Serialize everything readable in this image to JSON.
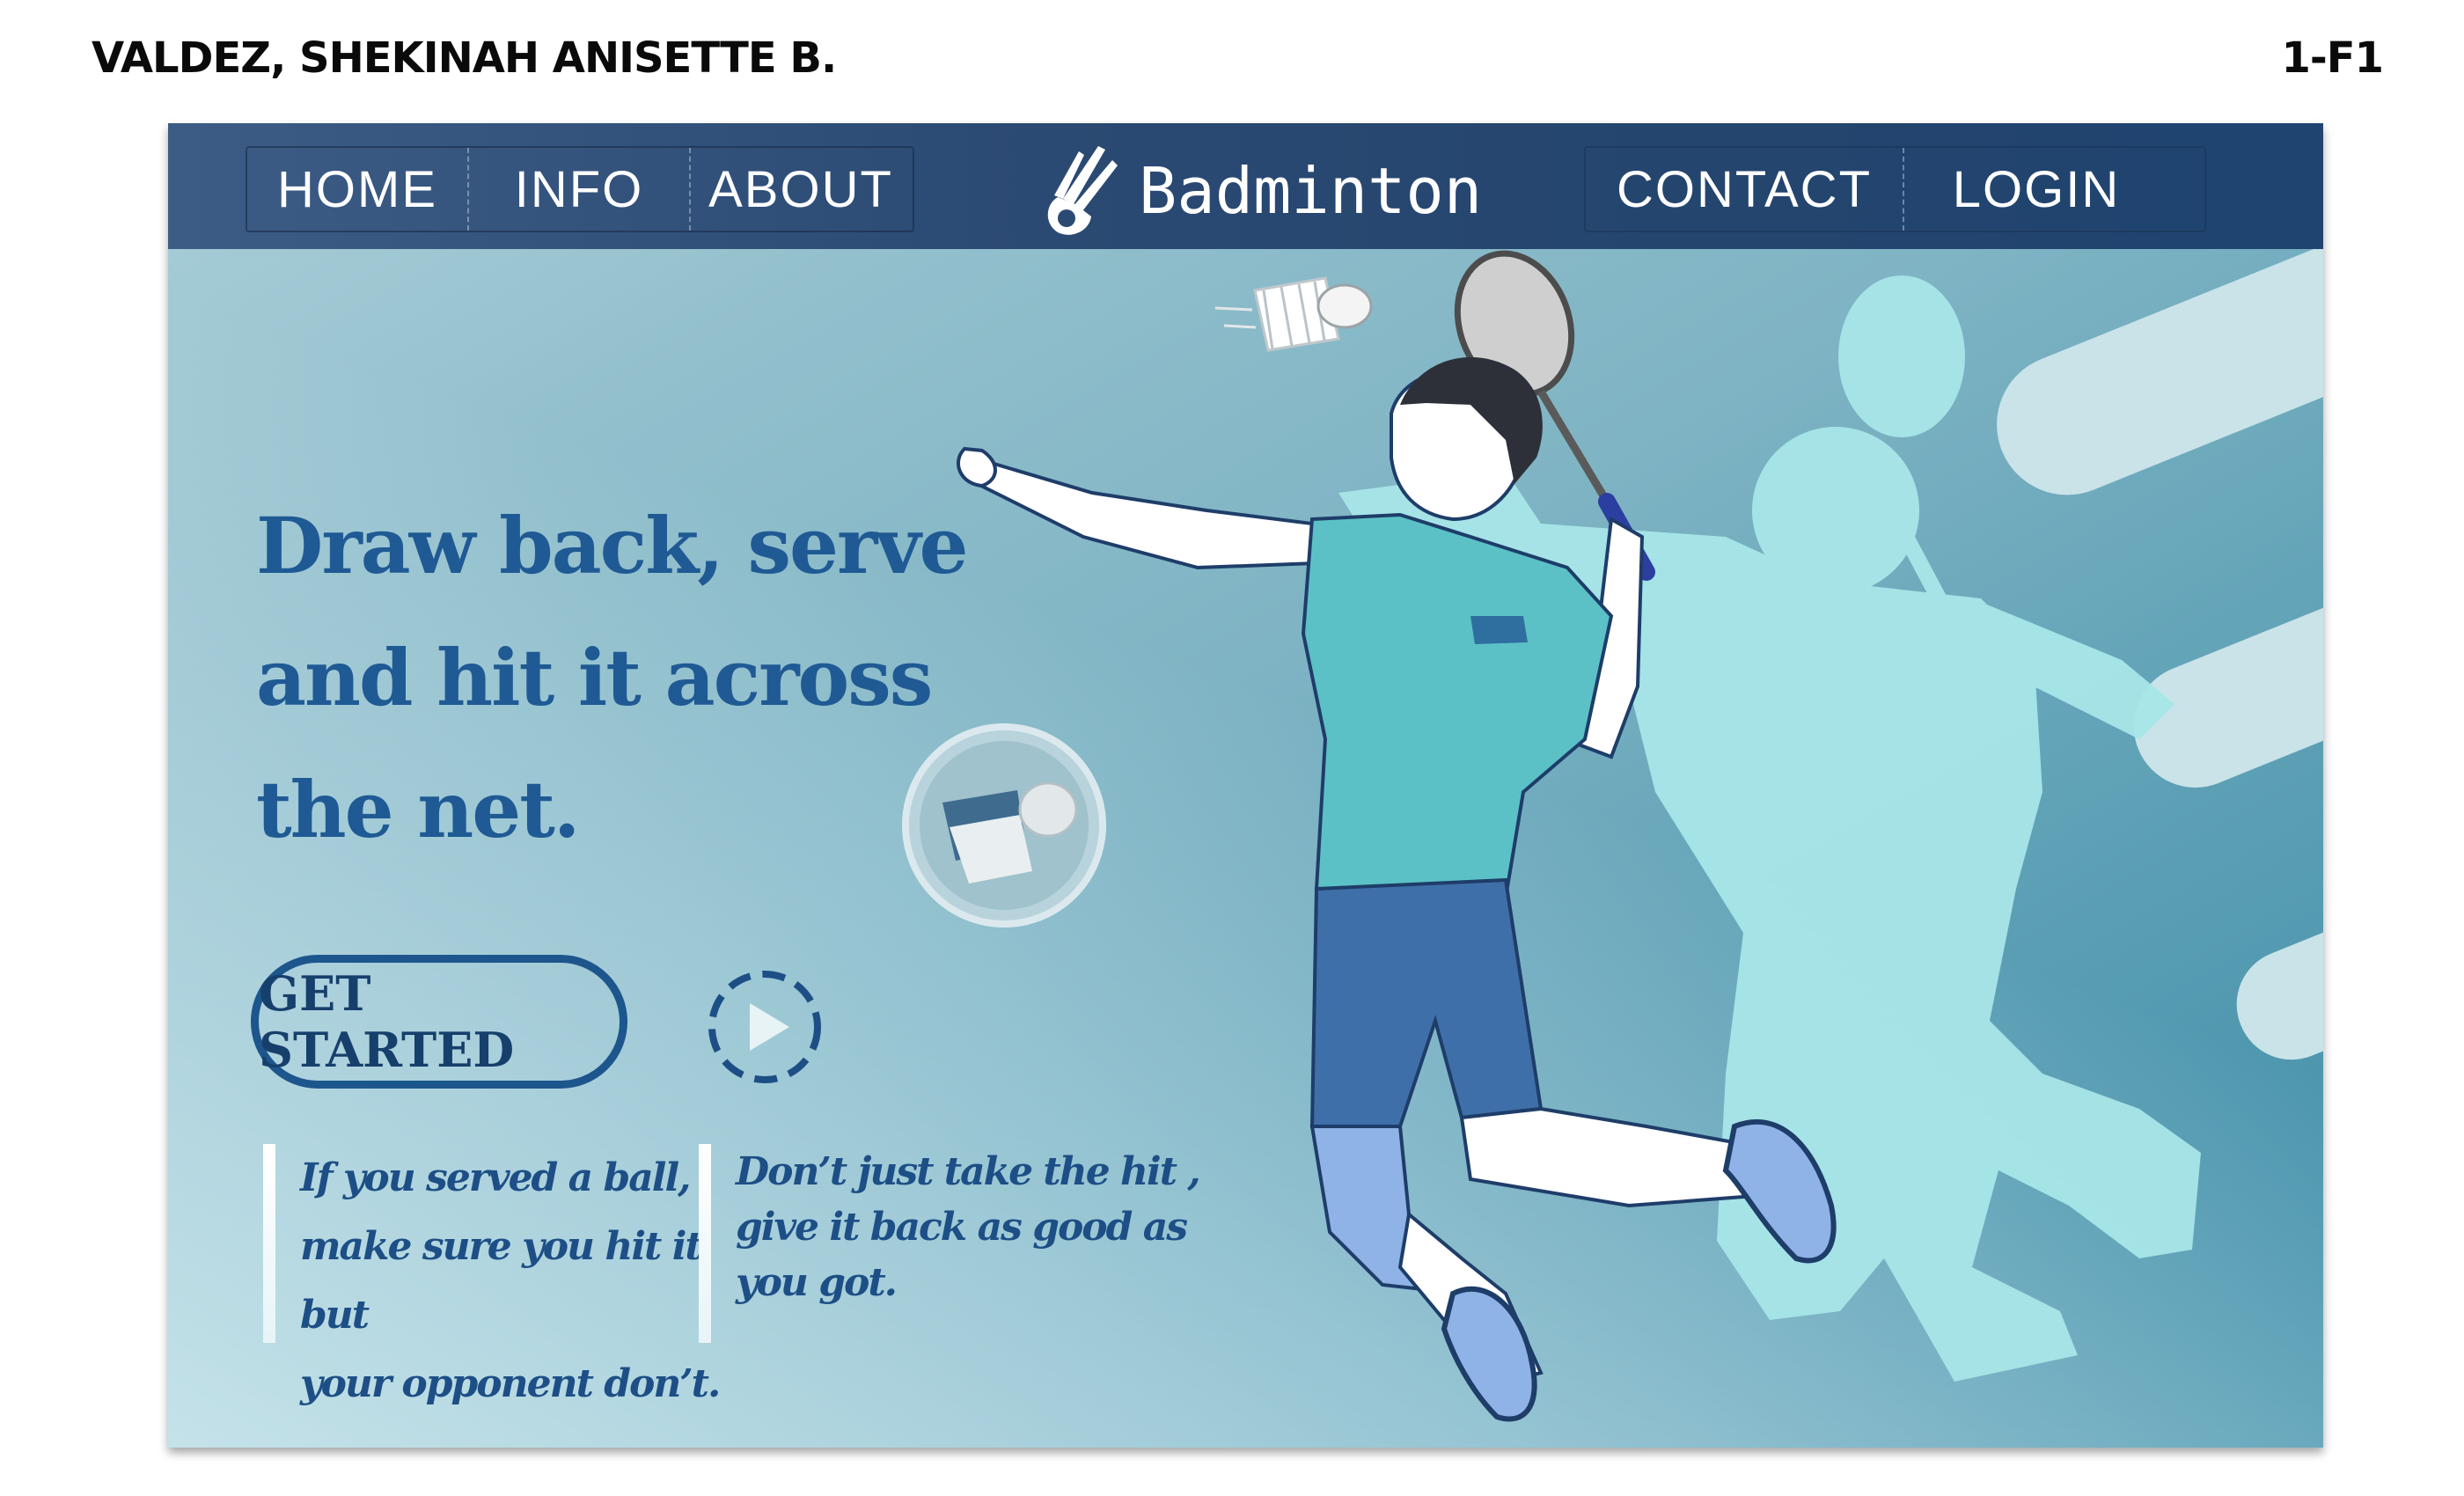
{
  "document": {
    "author": "VALDEZ, SHEKINAH ANISETTE B.",
    "code": "1-F1"
  },
  "nav": {
    "left_items": [
      "HOME",
      "INFO",
      "ABOUT"
    ],
    "brand": "Badminton",
    "right_items": [
      "CONTACT",
      "LOGIN"
    ]
  },
  "hero": {
    "headline_lines": [
      "Draw back, serve",
      "and hit it across",
      "the net."
    ],
    "cta_label": "GET STARTED",
    "quote_1_lines": [
      "If you served a ball,",
      "make sure you hit it but",
      "your opponent don’t."
    ],
    "quote_2_lines": [
      "Don’t just take the hit ,",
      "give it back as good as",
      "you got."
    ]
  },
  "colors": {
    "nav_bg": "#2b4a73",
    "headline": "#1f5a94",
    "accent": "#1d568c",
    "shirt": "#5cc1c6",
    "shorts": "#3f6fa8",
    "silhouette": "#a8e6e8"
  },
  "icons": {
    "brand": "shuttlecock-icon",
    "play": "play-icon",
    "badge": "shuttlecock-badge-icon"
  }
}
